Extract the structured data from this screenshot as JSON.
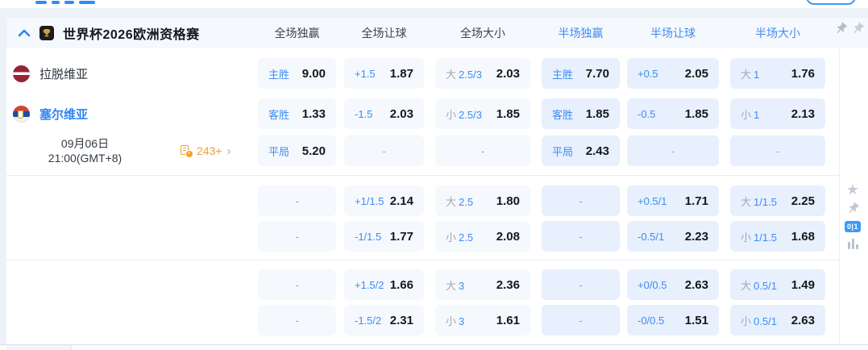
{
  "colors": {
    "accent_blue": "#3d8cf7",
    "fulltime_cell_bg": "#f5f8fc",
    "halftime_cell_bg": "#e7f0fc",
    "odds_value_text": "#15181d",
    "muted_gray": "#9aa5b2",
    "markets_orange": "#f59e2e",
    "icon_gray": "#c5cdd7"
  },
  "header": {
    "league_title": "世界杯2026欧洲资格赛",
    "columns": [
      {
        "label": "全场独赢",
        "scope": "fulltime"
      },
      {
        "label": "全场让球",
        "scope": "fulltime"
      },
      {
        "label": "全场大小",
        "scope": "fulltime"
      },
      {
        "label": "半场独赢",
        "scope": "halftime"
      },
      {
        "label": "半场让球",
        "scope": "halftime"
      },
      {
        "label": "半场大小",
        "scope": "halftime"
      }
    ]
  },
  "match": {
    "home_team": "拉脱维亚",
    "away_team": "塞尔维亚",
    "date": "09月06日",
    "time": "21:00(GMT+8)",
    "markets_count": "243+",
    "corner_badge": "0|1"
  },
  "odds": {
    "rows": [
      {
        "cells": [
          {
            "label": "主胜",
            "value": "9.00"
          },
          {
            "label": "+1.5",
            "value": "1.87"
          },
          {
            "prefix": "大",
            "label": "2.5/3",
            "value": "2.03"
          },
          {
            "label": "主胜",
            "value": "7.70"
          },
          {
            "label": "+0.5",
            "value": "2.05"
          },
          {
            "prefix": "大",
            "label": "1",
            "value": "1.76"
          }
        ]
      },
      {
        "cells": [
          {
            "label": "客胜",
            "value": "1.33"
          },
          {
            "label": "-1.5",
            "value": "2.03"
          },
          {
            "prefix": "小",
            "label": "2.5/3",
            "value": "1.85"
          },
          {
            "label": "客胜",
            "value": "1.85"
          },
          {
            "label": "-0.5",
            "value": "1.85"
          },
          {
            "prefix": "小",
            "label": "1",
            "value": "2.13"
          }
        ]
      },
      {
        "cells": [
          {
            "label": "平局",
            "value": "5.20"
          },
          null,
          null,
          {
            "label": "平局",
            "value": "2.43"
          },
          null,
          null
        ]
      },
      {
        "cells": [
          null,
          {
            "label": "+1/1.5",
            "value": "2.14"
          },
          {
            "prefix": "大",
            "label": "2.5",
            "value": "1.80"
          },
          null,
          {
            "label": "+0.5/1",
            "value": "1.71"
          },
          {
            "prefix": "大",
            "label": "1/1.5",
            "value": "2.25"
          }
        ]
      },
      {
        "cells": [
          null,
          {
            "label": "-1/1.5",
            "value": "1.77"
          },
          {
            "prefix": "小",
            "label": "2.5",
            "value": "2.08"
          },
          null,
          {
            "label": "-0.5/1",
            "value": "2.23"
          },
          {
            "prefix": "小",
            "label": "1/1.5",
            "value": "1.68"
          }
        ]
      },
      {
        "cells": [
          null,
          {
            "label": "+1.5/2",
            "value": "1.66"
          },
          {
            "prefix": "大",
            "label": "3",
            "value": "2.36"
          },
          null,
          {
            "label": "+0/0.5",
            "value": "2.63"
          },
          {
            "prefix": "大",
            "label": "0.5/1",
            "value": "1.49"
          }
        ]
      },
      {
        "cells": [
          null,
          {
            "label": "-1.5/2",
            "value": "2.31"
          },
          {
            "prefix": "小",
            "label": "3",
            "value": "1.61"
          },
          null,
          {
            "label": "-0/0.5",
            "value": "1.51"
          },
          {
            "prefix": "小",
            "label": "0.5/1",
            "value": "2.63"
          }
        ]
      }
    ]
  }
}
